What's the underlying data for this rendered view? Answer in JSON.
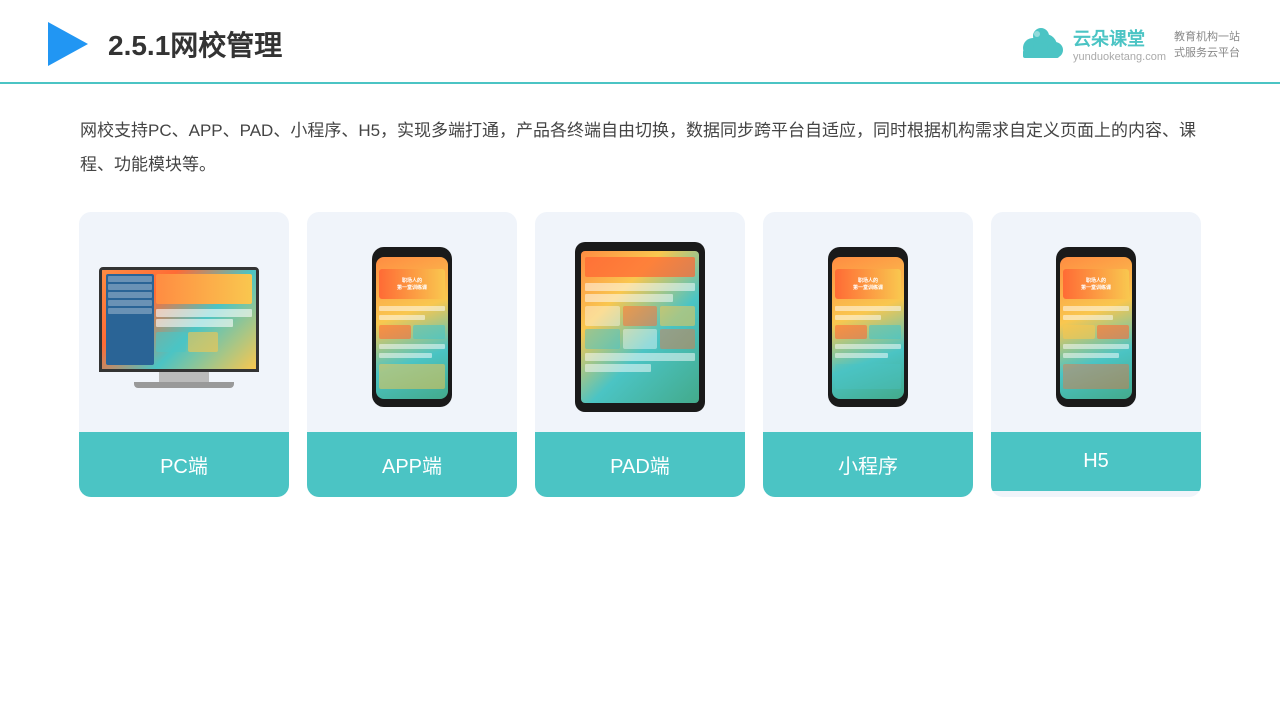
{
  "header": {
    "title": "2.5.1网校管理",
    "logo_name": "云朵课堂",
    "logo_url": "yunduoketang.com",
    "logo_tagline": "教育机构一站\n式服务云平台"
  },
  "description": {
    "text": "网校支持PC、APP、PAD、小程序、H5，实现多端打通，产品各终端自由切换，数据同步跨平台自适应，同时根据机构需求自定义页面上的内容、课程、功能模块等。"
  },
  "cards": [
    {
      "id": "pc",
      "label": "PC端"
    },
    {
      "id": "app",
      "label": "APP端"
    },
    {
      "id": "pad",
      "label": "PAD端"
    },
    {
      "id": "miniprogram",
      "label": "小程序"
    },
    {
      "id": "h5",
      "label": "H5"
    }
  ],
  "colors": {
    "accent": "#4bc4c4",
    "background": "#f0f4fa",
    "dark": "#1a1a1a"
  }
}
